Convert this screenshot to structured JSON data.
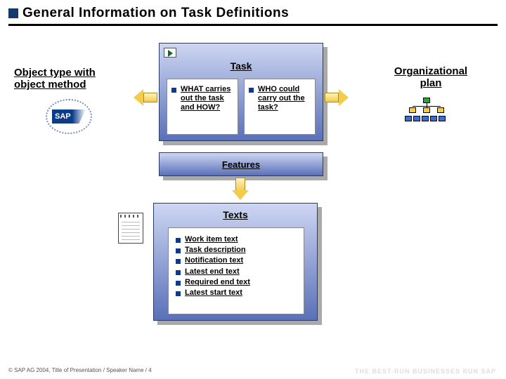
{
  "title": "General Information on Task Definitions",
  "task": {
    "heading": "Task",
    "what": "WHAT carries out the task and HOW?",
    "who": "WHO could carry out the task?"
  },
  "features_heading": "Features",
  "texts": {
    "heading": "Texts",
    "items": [
      "Work item text",
      "Task description",
      "Notification text",
      "Latest end text",
      "Required end text",
      "Latest start text"
    ]
  },
  "left_label": "Object type with object method",
  "right_label": "Organizational plan",
  "sap_logo_text": "SAP",
  "footer": "SAP AG 2004, Title of Presentation / Speaker Name / 4",
  "tagline": "THE BEST-RUN BUSINESSES RUN SAP"
}
